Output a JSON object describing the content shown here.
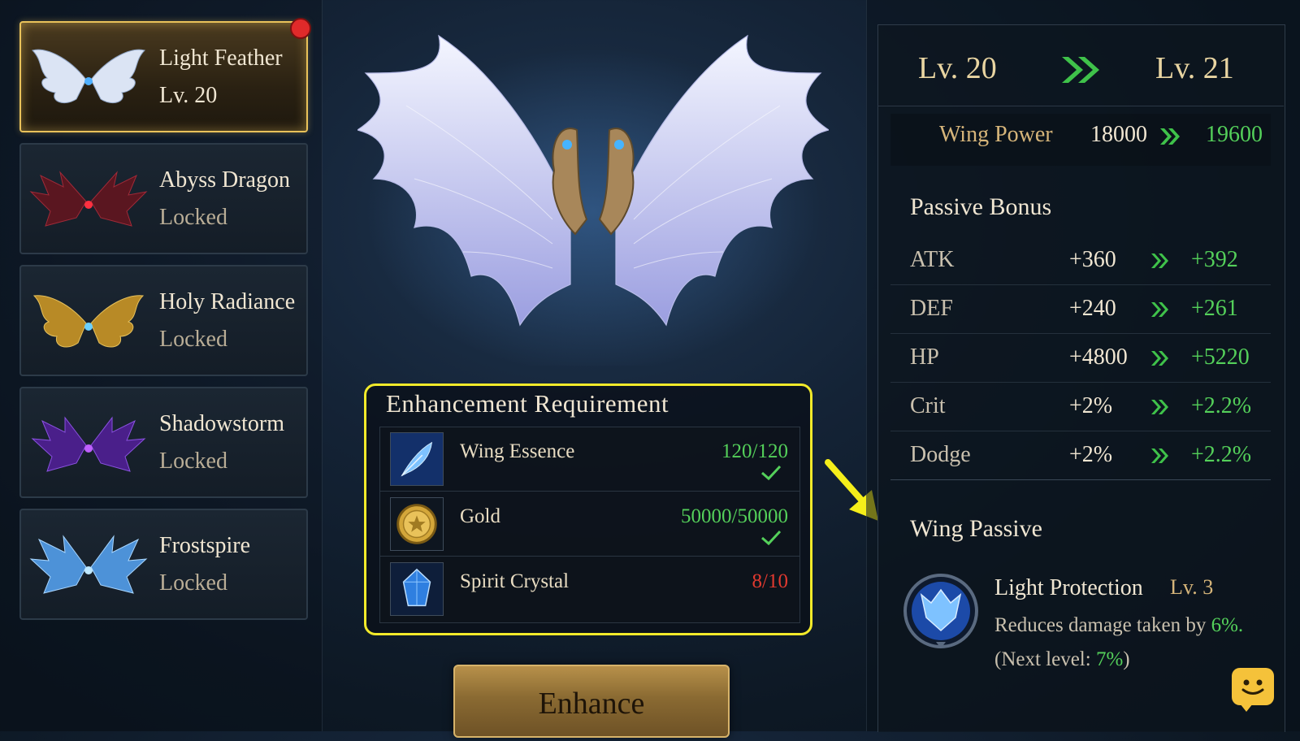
{
  "wing_list": {
    "items": [
      {
        "name": "Light Feather",
        "status": "Lv. 20",
        "selected": true,
        "has_notification": true,
        "color": "#dbe4f4"
      },
      {
        "name": "Abyss Dragon",
        "status": "Locked",
        "selected": false,
        "has_notification": false,
        "color": "#8a1f2a"
      },
      {
        "name": "Holy Radiance",
        "status": "Locked",
        "selected": false,
        "has_notification": false,
        "color": "#c99a2e"
      },
      {
        "name": "Shadowstorm",
        "status": "Locked",
        "selected": false,
        "has_notification": false,
        "color": "#6a2fc0"
      },
      {
        "name": "Frostspire",
        "status": "Locked",
        "selected": false,
        "has_notification": false,
        "color": "#5aa8e8"
      }
    ]
  },
  "requirements": {
    "title": "Enhancement Requirement",
    "items": [
      {
        "name": "Wing Essence",
        "value": "120/120",
        "met": true,
        "icon": "feather-icon"
      },
      {
        "name": "Gold",
        "value": "50000/50000",
        "met": true,
        "icon": "gold-coin-icon"
      },
      {
        "name": "Spirit Crystal",
        "value": "8/10",
        "met": false,
        "icon": "crystal-icon"
      }
    ]
  },
  "enhance_button": {
    "label": "Enhance"
  },
  "level": {
    "current": "Lv. 20",
    "next": "Lv. 21"
  },
  "wing_power": {
    "label": "Wing Power",
    "current": "18000",
    "next": "19600"
  },
  "passive_bonus": {
    "title": "Passive Bonus",
    "stats": [
      {
        "name": "ATK",
        "current": "+360",
        "next": "+392"
      },
      {
        "name": "DEF",
        "current": "+240",
        "next": "+261"
      },
      {
        "name": "HP",
        "current": "+4800",
        "next": "+5220"
      },
      {
        "name": "Crit",
        "current": "+2%",
        "next": "+2.2%"
      },
      {
        "name": "Dodge",
        "current": "+2%",
        "next": "+2.2%"
      }
    ]
  },
  "wing_passive": {
    "title": "Wing Passive",
    "skill_name": "Light Protection",
    "skill_level": "Lv. 3",
    "desc_prefix": "Reduces damage taken by ",
    "desc_value": "6%.",
    "next_prefix": "(Next level: ",
    "next_value": "7%",
    "next_suffix": ")"
  },
  "colors": {
    "accent_gold": "#e9c25a",
    "positive": "#54d05a",
    "negative": "#e0392f",
    "highlight_yellow": "#f2ea2a"
  }
}
